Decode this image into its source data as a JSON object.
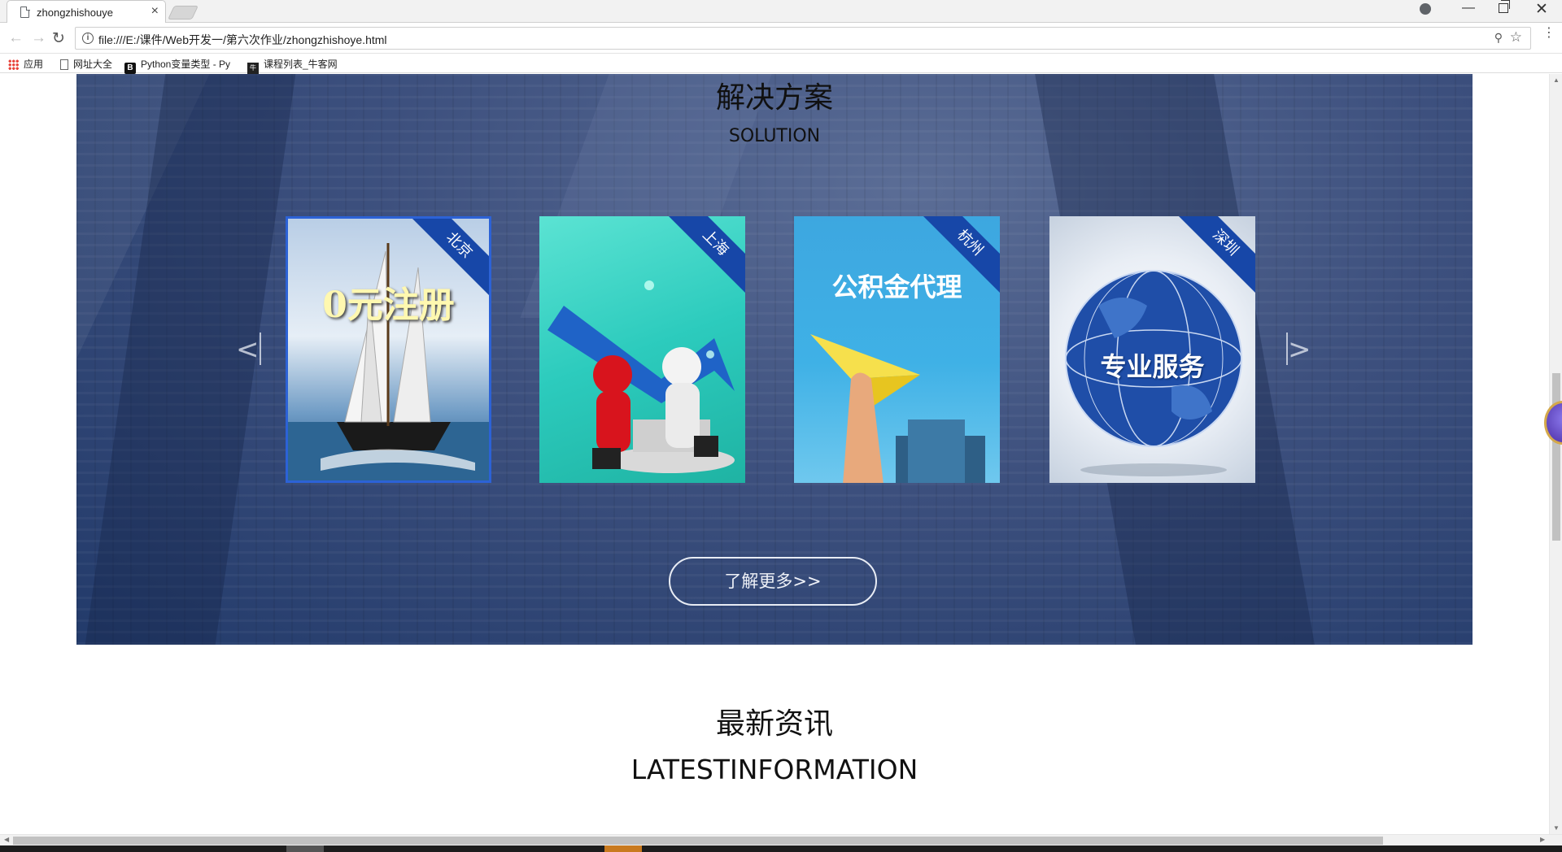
{
  "browser": {
    "tab_title": "zhongzhishouye",
    "tab_close": "×",
    "url": "file:///E:/课件/Web开发一/第六次作业/zhongzhishoye.html",
    "bookmarks": [
      "应用",
      "网址大全",
      "Python变量类型 - Py",
      "课程列表_牛客网"
    ]
  },
  "solution": {
    "title": "解决方案",
    "subtitle": "SOLUTION",
    "cards": [
      {
        "city": "北京",
        "text": "0元注册"
      },
      {
        "city": "上海",
        "text": ""
      },
      {
        "city": "杭州",
        "text": "公积金代理"
      },
      {
        "city": "深圳",
        "text": "专业服务"
      }
    ],
    "prev_arrow": "<",
    "next_arrow": ">",
    "more_button": "了解更多>>"
  },
  "latest": {
    "title": "最新资讯",
    "subtitle": "LATESTINFORMATION"
  },
  "colors": {
    "ribbon": "#1747a8",
    "active_border": "#2c62d6",
    "banner_bg": "#3d507e"
  }
}
